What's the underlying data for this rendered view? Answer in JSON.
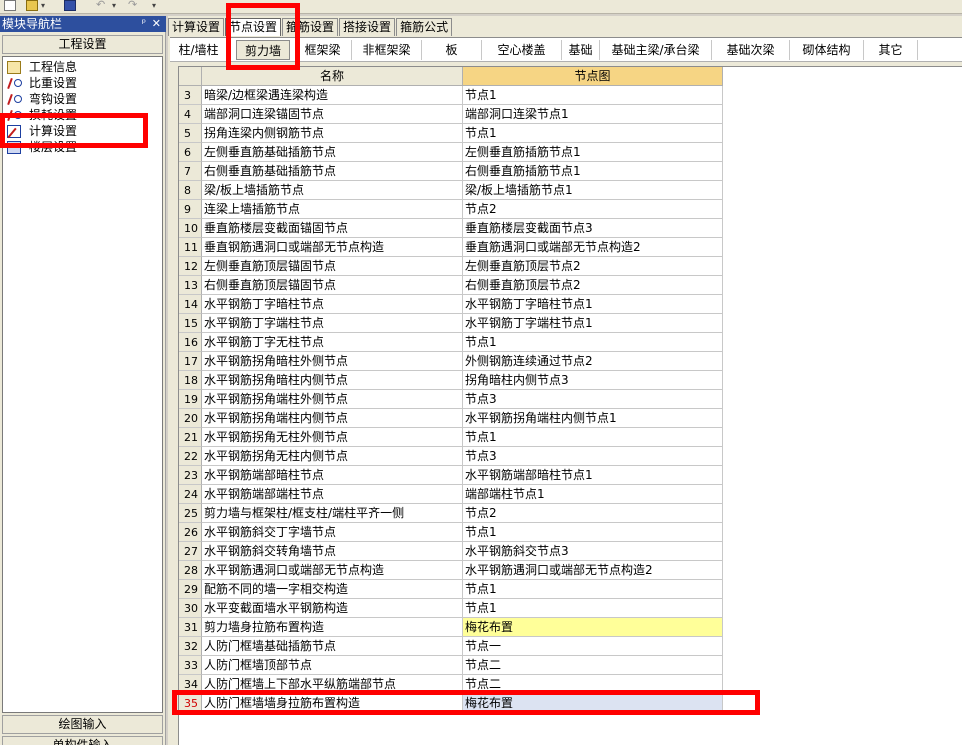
{
  "toolbar": {
    "icons": [
      "new-file-icon",
      "open-folder-icon",
      "save-icon",
      "undo-icon",
      "redo-icon"
    ]
  },
  "left_panel": {
    "title": "模块导航栏",
    "pin": "ᵖ",
    "close": "✕",
    "header": "工程设置",
    "items": [
      {
        "label": "工程信息",
        "icon": "project-info-icon"
      },
      {
        "label": "比重设置",
        "icon": "ratio-settings-icon"
      },
      {
        "label": "弯钩设置",
        "icon": "hook-settings-icon"
      },
      {
        "label": "损耗设置",
        "icon": "loss-settings-icon"
      },
      {
        "label": "计算设置",
        "icon": "calc-settings-icon"
      },
      {
        "label": "楼层设置",
        "icon": "floor-settings-icon"
      }
    ],
    "bottom_tabs": [
      "绘图输入",
      "单构件输入"
    ]
  },
  "top_tabs": [
    {
      "label": "计算设置",
      "active": false
    },
    {
      "label": "节点设置",
      "active": true
    },
    {
      "label": "箍筋设置",
      "active": false
    },
    {
      "label": "搭接设置",
      "active": false
    },
    {
      "label": "箍筋公式",
      "active": false
    }
  ],
  "sub_tabs": [
    {
      "label": "柱/墙柱",
      "active": false
    },
    {
      "label": "剪力墙",
      "active": true
    },
    {
      "label": "框架梁",
      "active": false
    },
    {
      "label": "非框架梁",
      "active": false
    },
    {
      "label": "板",
      "active": false
    },
    {
      "label": "空心楼盖",
      "active": false
    },
    {
      "label": "基础",
      "active": false
    },
    {
      "label": "基础主梁/承台梁",
      "active": false
    },
    {
      "label": "基础次梁",
      "active": false
    },
    {
      "label": "砌体结构",
      "active": false
    },
    {
      "label": "其它",
      "active": false
    }
  ],
  "grid": {
    "columns": {
      "name": "名称",
      "node": "节点图"
    },
    "rows": [
      {
        "num": "3",
        "name": "暗梁/边框梁遇连梁构造",
        "node": "节点1"
      },
      {
        "num": "4",
        "name": "端部洞口连梁锚固节点",
        "node": "端部洞口连梁节点1"
      },
      {
        "num": "5",
        "name": "拐角连梁内侧钢筋节点",
        "node": "节点1"
      },
      {
        "num": "6",
        "name": "左侧垂直筋基础插筋节点",
        "node": "左侧垂直筋插筋节点1"
      },
      {
        "num": "7",
        "name": "右侧垂直筋基础插筋节点",
        "node": "右侧垂直筋插筋节点1"
      },
      {
        "num": "8",
        "name": "梁/板上墙插筋节点",
        "node": "梁/板上墙插筋节点1"
      },
      {
        "num": "9",
        "name": "连梁上墙插筋节点",
        "node": "节点2"
      },
      {
        "num": "10",
        "name": "垂直筋楼层变截面锚固节点",
        "node": "垂直筋楼层变截面节点3"
      },
      {
        "num": "11",
        "name": "垂直钢筋遇洞口或端部无节点构造",
        "node": "垂直筋遇洞口或端部无节点构造2"
      },
      {
        "num": "12",
        "name": "左侧垂直筋顶层锚固节点",
        "node": "左侧垂直筋顶层节点2"
      },
      {
        "num": "13",
        "name": "右侧垂直筋顶层锚固节点",
        "node": "右侧垂直筋顶层节点2"
      },
      {
        "num": "14",
        "name": "水平钢筋丁字暗柱节点",
        "node": "水平钢筋丁字暗柱节点1"
      },
      {
        "num": "15",
        "name": "水平钢筋丁字端柱节点",
        "node": "水平钢筋丁字端柱节点1"
      },
      {
        "num": "16",
        "name": "水平钢筋丁字无柱节点",
        "node": "节点1"
      },
      {
        "num": "17",
        "name": "水平钢筋拐角暗柱外侧节点",
        "node": "外侧钢筋连续通过节点2"
      },
      {
        "num": "18",
        "name": "水平钢筋拐角暗柱内侧节点",
        "node": "拐角暗柱内侧节点3"
      },
      {
        "num": "19",
        "name": "水平钢筋拐角端柱外侧节点",
        "node": "节点3"
      },
      {
        "num": "20",
        "name": "水平钢筋拐角端柱内侧节点",
        "node": "水平钢筋拐角端柱内侧节点1"
      },
      {
        "num": "21",
        "name": "水平钢筋拐角无柱外侧节点",
        "node": "节点1"
      },
      {
        "num": "22",
        "name": "水平钢筋拐角无柱内侧节点",
        "node": "节点3"
      },
      {
        "num": "23",
        "name": "水平钢筋端部暗柱节点",
        "node": "水平钢筋端部暗柱节点1"
      },
      {
        "num": "24",
        "name": "水平钢筋端部端柱节点",
        "node": "端部端柱节点1"
      },
      {
        "num": "25",
        "name": "剪力墙与框架柱/框支柱/端柱平齐一侧",
        "node": "节点2"
      },
      {
        "num": "26",
        "name": "水平钢筋斜交丁字墙节点",
        "node": "节点1"
      },
      {
        "num": "27",
        "name": "水平钢筋斜交转角墙节点",
        "node": "水平钢筋斜交节点3"
      },
      {
        "num": "28",
        "name": "水平钢筋遇洞口或端部无节点构造",
        "node": "水平钢筋遇洞口或端部无节点构造2"
      },
      {
        "num": "29",
        "name": "配筋不同的墙一字相交构造",
        "node": "节点1"
      },
      {
        "num": "30",
        "name": "水平变截面墙水平钢筋构造",
        "node": "节点1"
      },
      {
        "num": "31",
        "name": "剪力墙身拉筋布置构造",
        "node": "梅花布置",
        "style": "yellow"
      },
      {
        "num": "32",
        "name": "人防门框墙基础插筋节点",
        "node": "节点一"
      },
      {
        "num": "33",
        "name": "人防门框墙顶部节点",
        "node": "节点二"
      },
      {
        "num": "34",
        "name": "人防门框墙上下部水平纵筋端部节点",
        "node": "节点二"
      },
      {
        "num": "35",
        "name": "人防门框墙墙身拉筋布置构造",
        "node": "梅花布置",
        "style": "selected"
      }
    ]
  },
  "colors": {
    "title_bar": "#2d4f9e",
    "header_node": "#f6d584",
    "highlight_row": "#ffff99",
    "annotation_red": "#ff0000"
  }
}
